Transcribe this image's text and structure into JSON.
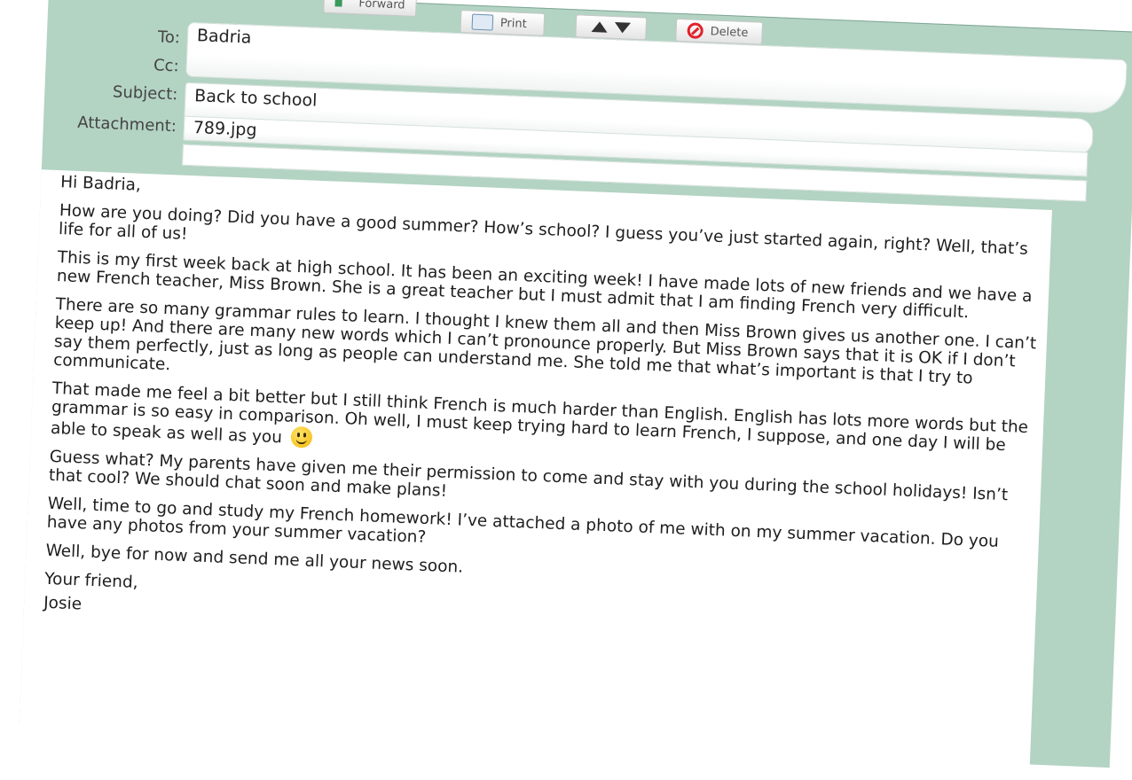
{
  "toolbar": {
    "forward_label": "Forward",
    "print_label": "Print",
    "delete_label": "Delete"
  },
  "header": {
    "to_label": "To:",
    "to_value": "Badria",
    "cc_label": "Cc:",
    "cc_value": "",
    "subject_label": "Subject:",
    "subject_value": "Back to school",
    "attachment_label": "Attachment:",
    "attachment_value": "789.jpg"
  },
  "message": {
    "greeting": "Hi Badria,",
    "paragraphs": [
      "How are you doing? Did you have a good summer? How’s school? I guess you’ve just started again, right? Well, that’s life for all of us!",
      "This is my first week back at high school. It has been an exciting week! I have made lots of new friends and we have a new French teacher, Miss Brown. She is a great teacher but I must admit that I am finding French very difficult.",
      "There are so many grammar rules to learn. I thought I knew them all and then Miss Brown gives us another one. I can’t keep up! And there are many new words which I can’t pronounce properly. But Miss Brown says that it is OK if I don’t say them perfectly, just as long as people can understand me. She told me that what’s important is that I try to communicate.",
      "That made me feel a bit better but I still think French is much harder than English. English has lots more words but the grammar is so easy in comparison. Oh well, I must keep trying hard to learn French, I suppose, and one day I will be able to speak as well as you",
      "Guess what? My parents have given me their permission to come and stay with you during the school holidays! Isn’t that cool? We should chat soon and make plans!",
      "Well, time to go and study my French homework! I’ve attached a photo of me with on my summer vacation. Do you have any photos from your summer vacation?",
      "Well, bye for now and send me all your news soon."
    ],
    "closing": "Your friend,",
    "signature": "Josie"
  },
  "colors": {
    "frame_green": "#b3d3c3",
    "delete_red": "#e3202a"
  },
  "icons": [
    "forward-icon",
    "print-icon",
    "arrow-up-icon",
    "arrow-down-icon",
    "delete-icon",
    "smiley-emoji-icon"
  ]
}
